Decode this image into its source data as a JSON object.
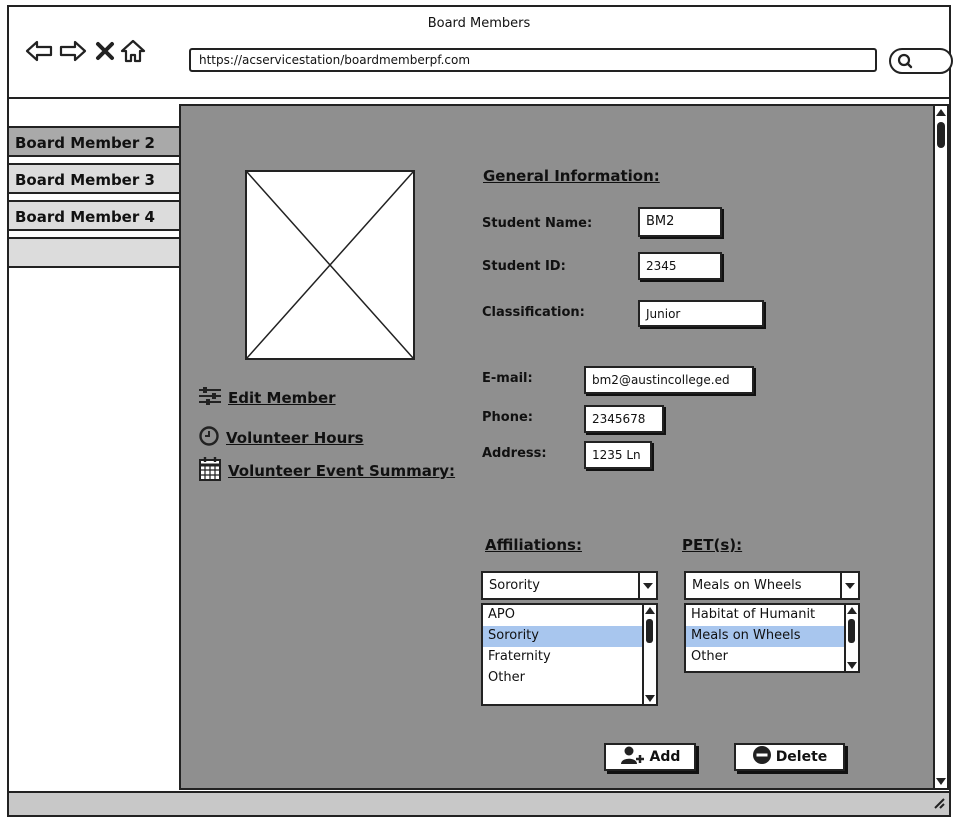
{
  "window": {
    "title": "Board Members",
    "url": "https://acservicestation/boardmemberpf.com"
  },
  "icons": {
    "back": "arrow-left-icon",
    "forward": "arrow-right-icon",
    "stop": "close-icon",
    "home": "home-icon",
    "search": "search-icon"
  },
  "tabs": [
    {
      "label": "Board Member 2",
      "active": true
    },
    {
      "label": "Board Member 3",
      "active": false
    },
    {
      "label": "Board Member 4",
      "active": false
    },
    {
      "label": "",
      "active": false
    }
  ],
  "actions": {
    "edit_member": "Edit Member",
    "volunteer_hours": "Volunteer Hours",
    "volunteer_event_summary": "Volunteer Event Summary:"
  },
  "general": {
    "heading": "General Information:",
    "student_name_label": "Student Name:",
    "student_name": "BM2",
    "student_id_label": "Student ID:",
    "student_id": "2345",
    "classification_label": "Classification:",
    "classification": "Junior",
    "email_label": "E-mail:",
    "email": "bm2@austincollege.ed",
    "phone_label": "Phone:",
    "phone": "2345678",
    "address_label": "Address:",
    "address": "1235 Ln"
  },
  "affiliations": {
    "heading": "Affiliations:",
    "selected": "Sorority",
    "options": [
      "APO",
      "Sorority",
      "Fraternity",
      "Other"
    ]
  },
  "pets": {
    "heading": "PET(s):",
    "selected": "Meals on Wheels",
    "options": [
      "Habitat of Humanit",
      "Meals on Wheels",
      "Other"
    ]
  },
  "buttons": {
    "add": "Add",
    "delete": "Delete"
  },
  "colors": {
    "panel": "#8f8f8f",
    "selection": "#a8c6ee"
  }
}
